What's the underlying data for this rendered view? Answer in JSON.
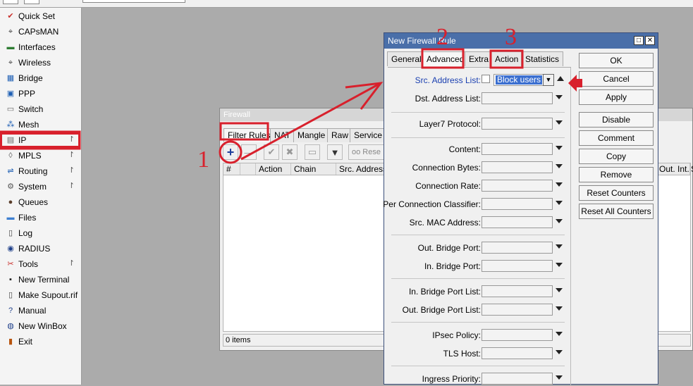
{
  "sidebar": {
    "items": [
      {
        "label": "Quick Set",
        "icon": "quick-set-icon",
        "glyph": "✔",
        "color": "#c9302c",
        "submenu": false
      },
      {
        "label": "CAPsMAN",
        "icon": "antenna-icon",
        "glyph": "⌖",
        "color": "#444444",
        "submenu": false
      },
      {
        "label": "Interfaces",
        "icon": "interfaces-icon",
        "glyph": "▬",
        "color": "#2e7d32",
        "submenu": false
      },
      {
        "label": "Wireless",
        "icon": "wireless-icon",
        "glyph": "⌖",
        "color": "#444444",
        "submenu": false
      },
      {
        "label": "Bridge",
        "icon": "bridge-icon",
        "glyph": "▦",
        "color": "#1e5fb4",
        "submenu": false
      },
      {
        "label": "PPP",
        "icon": "ppp-icon",
        "glyph": "▣",
        "color": "#1e5fb4",
        "submenu": false
      },
      {
        "label": "Switch",
        "icon": "switch-icon",
        "glyph": "▭",
        "color": "#666666",
        "submenu": false
      },
      {
        "label": "Mesh",
        "icon": "mesh-icon",
        "glyph": "⁂",
        "color": "#1e5fb4",
        "submenu": false
      },
      {
        "label": "IP",
        "icon": "ip-icon",
        "glyph": "▤",
        "color": "#666666",
        "submenu": true
      },
      {
        "label": "MPLS",
        "icon": "mpls-icon",
        "glyph": "◊",
        "color": "#666666",
        "submenu": true
      },
      {
        "label": "Routing",
        "icon": "routing-icon",
        "glyph": "⇌",
        "color": "#1e5fb4",
        "submenu": true
      },
      {
        "label": "System",
        "icon": "system-gear-icon",
        "glyph": "⚙",
        "color": "#555555",
        "submenu": true
      },
      {
        "label": "Queues",
        "icon": "queues-icon",
        "glyph": "●",
        "color": "#5a3e2b",
        "submenu": false
      },
      {
        "label": "Files",
        "icon": "files-folder-icon",
        "glyph": "▬",
        "color": "#3d7fd1",
        "submenu": false
      },
      {
        "label": "Log",
        "icon": "log-icon",
        "glyph": "▯",
        "color": "#444444",
        "submenu": false
      },
      {
        "label": "RADIUS",
        "icon": "radius-icon",
        "glyph": "◉",
        "color": "#1e3f8a",
        "submenu": false
      },
      {
        "label": "Tools",
        "icon": "tools-icon",
        "glyph": "✂",
        "color": "#c9302c",
        "submenu": true
      },
      {
        "label": "New Terminal",
        "icon": "terminal-icon",
        "glyph": "▪",
        "color": "#222222",
        "submenu": false
      },
      {
        "label": "Make Supout.rif",
        "icon": "supout-icon",
        "glyph": "▯",
        "color": "#444444",
        "submenu": false
      },
      {
        "label": "Manual",
        "icon": "manual-help-icon",
        "glyph": "?",
        "color": "#1e3f8a",
        "submenu": false
      },
      {
        "label": "New WinBox",
        "icon": "winbox-globe-icon",
        "glyph": "◍",
        "color": "#1e3f8a",
        "submenu": false
      },
      {
        "label": "Exit",
        "icon": "exit-icon",
        "glyph": "▮",
        "color": "#b8550f",
        "submenu": false
      }
    ]
  },
  "firewall": {
    "title": "Firewall",
    "tabs": [
      "Filter Rules",
      "NAT",
      "Mangle",
      "Raw",
      "Service P"
    ],
    "toolbar": {
      "add_icon": "plus-icon",
      "reset_label": "Rese"
    },
    "columns": [
      "#",
      "",
      "Action",
      "Chain",
      "Src. Address",
      "Out. Int...",
      "S"
    ],
    "status": "0 items"
  },
  "dialog": {
    "title": "New Firewall Rule",
    "tabs": [
      "General",
      "Advanced",
      "Extra",
      "Action",
      "Statistics"
    ],
    "src_address_list": {
      "label": "Src. Address List:",
      "value": "Block users"
    },
    "fields": [
      "Dst. Address List:",
      "Layer7 Protocol:",
      "Content:",
      "Connection Bytes:",
      "Connection Rate:",
      "Per Connection Classifier:",
      "Src. MAC Address:",
      "Out. Bridge Port:",
      "In. Bridge Port:",
      "In. Bridge Port List:",
      "Out. Bridge Port List:",
      "IPsec Policy:",
      "TLS Host:",
      "Ingress Priority:"
    ],
    "buttons": [
      "OK",
      "Cancel",
      "Apply",
      "Disable",
      "Comment",
      "Copy",
      "Remove",
      "Reset Counters",
      "Reset All Counters"
    ]
  },
  "annotations": {
    "step1": "1",
    "step2": "2",
    "step3": "3",
    "color": "#d8202c"
  }
}
